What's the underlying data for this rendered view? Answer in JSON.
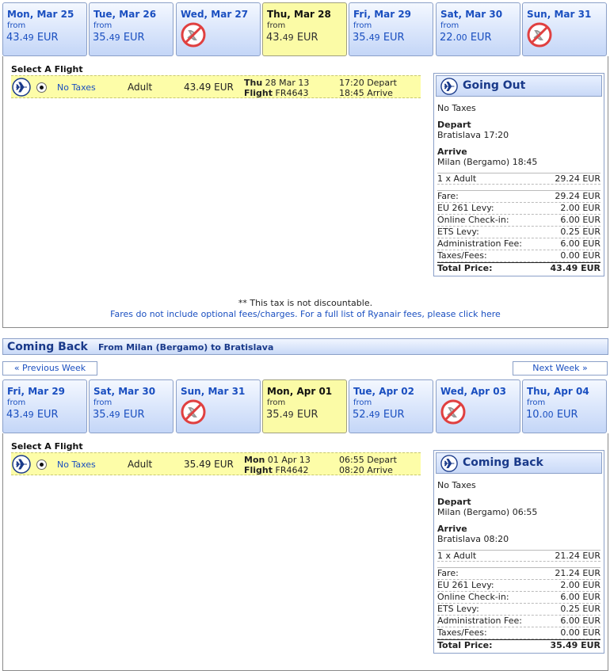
{
  "outbound": {
    "days": [
      {
        "name": "Mon, Mar 25",
        "from": "from",
        "price_main": "43.",
        "price_dec": "49",
        "currency": " EUR",
        "available": true,
        "selected": false
      },
      {
        "name": "Tue, Mar 26",
        "from": "from",
        "price_main": "35.",
        "price_dec": "49",
        "currency": " EUR",
        "available": true,
        "selected": false
      },
      {
        "name": "Wed, Mar 27",
        "available": false,
        "selected": false
      },
      {
        "name": "Thu, Mar 28",
        "from": "from",
        "price_main": "43.",
        "price_dec": "49",
        "currency": " EUR",
        "available": true,
        "selected": true
      },
      {
        "name": "Fri, Mar 29",
        "from": "from",
        "price_main": "35.",
        "price_dec": "49",
        "currency": " EUR",
        "available": true,
        "selected": false
      },
      {
        "name": "Sat, Mar 30",
        "from": "from",
        "price_main": "22.",
        "price_dec": "00",
        "currency": " EUR",
        "available": true,
        "selected": false
      },
      {
        "name": "Sun, Mar 31",
        "available": false,
        "selected": false
      }
    ],
    "select_title": "Select A Flight",
    "flight": {
      "taxes": "No Taxes",
      "passenger": "Adult",
      "price": "43.49 EUR",
      "day": "Thu",
      "date": "28 Mar 13",
      "flight_label": "Flight",
      "flight_no": "FR4643",
      "depart_time": "17:20 Depart",
      "arrive_time": "18:45 Arrive"
    },
    "summary": {
      "title": "Going Out",
      "taxes": "No Taxes",
      "depart_label": "Depart",
      "depart_value": "Bratislava 17:20",
      "arrive_label": "Arrive",
      "arrive_value": "Milan (Bergamo) 18:45",
      "pax_label": "1 x Adult",
      "pax_value": "29.24 EUR",
      "fare_label": "Fare:",
      "fare_value": "29.24 EUR",
      "eu261_label": "EU 261 Levy:",
      "eu261_value": "2.00 EUR",
      "checkin_label": "Online Check-in:",
      "checkin_value": "6.00 EUR",
      "ets_label": "ETS Levy:",
      "ets_value": "0.25 EUR",
      "admin_label": "Administration Fee:",
      "admin_value": "6.00 EUR",
      "taxes_label": "Taxes/Fees:",
      "taxes_value": "0.00 EUR",
      "total_label": "Total Price:",
      "total_value": "43.49 EUR"
    },
    "note_tax": "** This tax is not discountable.",
    "note_fees": "Fares do not include optional fees/charges. For a full list of Ryanair fees, please click here"
  },
  "coming_back": {
    "title": "Coming Back",
    "route": "From Milan (Bergamo) to Bratislava",
    "prev_week": "« Previous Week",
    "next_week": "Next Week »",
    "days": [
      {
        "name": "Fri, Mar 29",
        "from": "from",
        "price_main": "43.",
        "price_dec": "49",
        "currency": " EUR",
        "available": true,
        "selected": false
      },
      {
        "name": "Sat, Mar 30",
        "from": "from",
        "price_main": "35.",
        "price_dec": "49",
        "currency": " EUR",
        "available": true,
        "selected": false
      },
      {
        "name": "Sun, Mar 31",
        "available": false,
        "selected": false
      },
      {
        "name": "Mon, Apr 01",
        "from": "from",
        "price_main": "35.",
        "price_dec": "49",
        "currency": " EUR",
        "available": true,
        "selected": true
      },
      {
        "name": "Tue, Apr 02",
        "from": "from",
        "price_main": "52.",
        "price_dec": "49",
        "currency": " EUR",
        "available": true,
        "selected": false
      },
      {
        "name": "Wed, Apr 03",
        "available": false,
        "selected": false
      },
      {
        "name": "Thu, Apr 04",
        "from": "from",
        "price_main": "10.",
        "price_dec": "00",
        "currency": " EUR",
        "available": true,
        "selected": false
      }
    ],
    "select_title": "Select A Flight",
    "flight": {
      "taxes": "No Taxes",
      "passenger": "Adult",
      "price": "35.49 EUR",
      "day": "Mon",
      "date": "01 Apr 13",
      "flight_label": "Flight",
      "flight_no": "FR4642",
      "depart_time": "06:55 Depart",
      "arrive_time": "08:20 Arrive"
    },
    "summary": {
      "title": "Coming Back",
      "taxes": "No Taxes",
      "depart_label": "Depart",
      "depart_value": "Milan (Bergamo) 06:55",
      "arrive_label": "Arrive",
      "arrive_value": "Bratislava 08:20",
      "pax_label": "1 x Adult",
      "pax_value": "21.24 EUR",
      "fare_label": "Fare:",
      "fare_value": "21.24 EUR",
      "eu261_label": "EU 261 Levy:",
      "eu261_value": "2.00 EUR",
      "checkin_label": "Online Check-in:",
      "checkin_value": "6.00 EUR",
      "ets_label": "ETS Levy:",
      "ets_value": "0.25 EUR",
      "admin_label": "Administration Fee:",
      "admin_value": "6.00 EUR",
      "taxes_label": "Taxes/Fees:",
      "taxes_value": "0.00 EUR",
      "total_label": "Total Price:",
      "total_value": "35.49 EUR"
    }
  },
  "icons": {
    "plane": "plane-icon",
    "no_flight": "no-flight-icon"
  },
  "colors": {
    "link": "#1a4fc0",
    "selected_day": "#fbfba6",
    "header_blue": "#1a3a8a",
    "no_flight": "#e04040"
  }
}
